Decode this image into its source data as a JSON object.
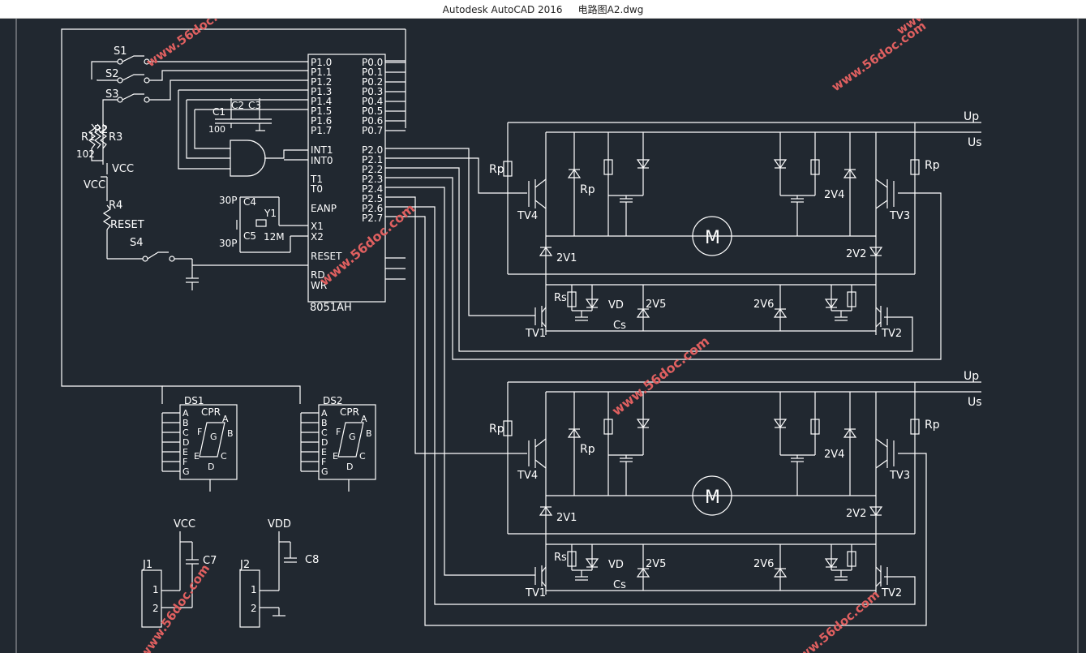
{
  "window": {
    "app_title": "Autodesk AutoCAD 2016",
    "file_name": "电路图A2.dwg"
  },
  "colors": {
    "background": "#212830",
    "lines": "#ffffff",
    "watermark": "#e06060"
  },
  "watermark_text": "www.56doc.com",
  "mcu": {
    "name": "8051AH",
    "p1_pins": [
      "P1.0",
      "P1.1",
      "P1.2",
      "P1.3",
      "P1.4",
      "P1.5",
      "P1.6",
      "P1.7"
    ],
    "p0_pins": [
      "P0.0",
      "P0.1",
      "P0.2",
      "P0.3",
      "P0.4",
      "P0.5",
      "P0.6",
      "P0.7"
    ],
    "p2_pins": [
      "P2.0",
      "P2.1",
      "P2.2",
      "P2.3",
      "P2.4",
      "P2.5",
      "P2.6",
      "P2.7"
    ],
    "left_pins": [
      "INT1",
      "INT0",
      "T1",
      "T0",
      "EANP",
      "X1",
      "X2",
      "RESET",
      "RD",
      "WR"
    ]
  },
  "input_section": {
    "switches": [
      "S1",
      "S2",
      "S3",
      "S4"
    ],
    "resistors": [
      "R1",
      "R2",
      "R3",
      "R4"
    ],
    "r_value": "102",
    "vcc": "VCC",
    "reset": "RESET",
    "caps": [
      "C1",
      "C2",
      "C3"
    ],
    "cap_value": "100",
    "osc": {
      "c4": "C4",
      "c5": "C5",
      "cap_value": "30P",
      "crystal": "Y1",
      "freq": "12M"
    }
  },
  "displays": [
    {
      "name": "DS1",
      "cpr": "CPR",
      "pins": [
        "A",
        "B",
        "C",
        "D",
        "E",
        "F",
        "G"
      ],
      "segs": [
        "A",
        "B",
        "C",
        "D",
        "E",
        "F",
        "G"
      ]
    },
    {
      "name": "DS2",
      "cpr": "CPR",
      "pins": [
        "A",
        "B",
        "C",
        "D",
        "E",
        "F",
        "G"
      ],
      "segs": [
        "A",
        "B",
        "C",
        "D",
        "E",
        "F",
        "G"
      ]
    }
  ],
  "power_connectors": [
    {
      "name": "J1",
      "rail": "VCC",
      "cap": "C7",
      "pins": [
        "1",
        "2"
      ]
    },
    {
      "name": "J2",
      "rail": "VDD",
      "cap": "C8",
      "pins": [
        "1",
        "2"
      ]
    }
  ],
  "motor_drivers": [
    {
      "up": "Up",
      "us": "Us",
      "motor": "M",
      "rp": "Rp",
      "transistors": [
        "TV1",
        "TV2",
        "TV3",
        "TV4"
      ],
      "diodes": [
        "2V1",
        "2V2",
        "2V4",
        "2V5",
        "2V6"
      ],
      "rs": "Rs",
      "vd": "VD",
      "cs": "Cs"
    },
    {
      "up": "Up",
      "us": "Us",
      "motor": "M",
      "rp": "Rp",
      "transistors": [
        "TV1",
        "TV2",
        "TV3",
        "TV4"
      ],
      "diodes": [
        "2V1",
        "2V2",
        "2V4",
        "2V5",
        "2V6"
      ],
      "rs": "Rs",
      "vd": "VD",
      "cs": "Cs"
    }
  ]
}
